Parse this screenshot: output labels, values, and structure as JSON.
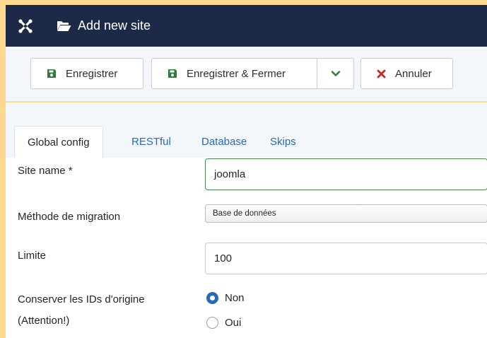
{
  "header": {
    "logo_icon": "joomla-logo-icon",
    "folder_icon": "folder-open-icon",
    "title": "Add new site"
  },
  "toolbar": {
    "save_label": "Enregistrer",
    "save_close_label": "Enregistrer & Fermer",
    "cancel_label": "Annuler",
    "save_icon": "floppy-disk-icon",
    "dropdown_icon": "chevron-down-icon",
    "cancel_icon": "times-icon",
    "accent_green": "#2f7a3a",
    "cancel_red": "#c52827"
  },
  "tabs": [
    {
      "label": "Global config",
      "active": true
    },
    {
      "label": "RESTful",
      "active": false
    },
    {
      "label": "Database",
      "active": false
    },
    {
      "label": "Skips",
      "active": false
    }
  ],
  "form": {
    "site_name_label": "Site name *",
    "site_name_value": "joomla",
    "method_label": "Méthode de migration",
    "method_value": "Base de données",
    "limit_label": "Limite",
    "limit_value": "100",
    "keep_ids_label_line1": "Conserver les IDs d'origine",
    "keep_ids_label_line2": "(Attention!)",
    "keep_ids_options": [
      {
        "label": "Non",
        "checked": true
      },
      {
        "label": "Oui",
        "checked": false
      }
    ]
  }
}
